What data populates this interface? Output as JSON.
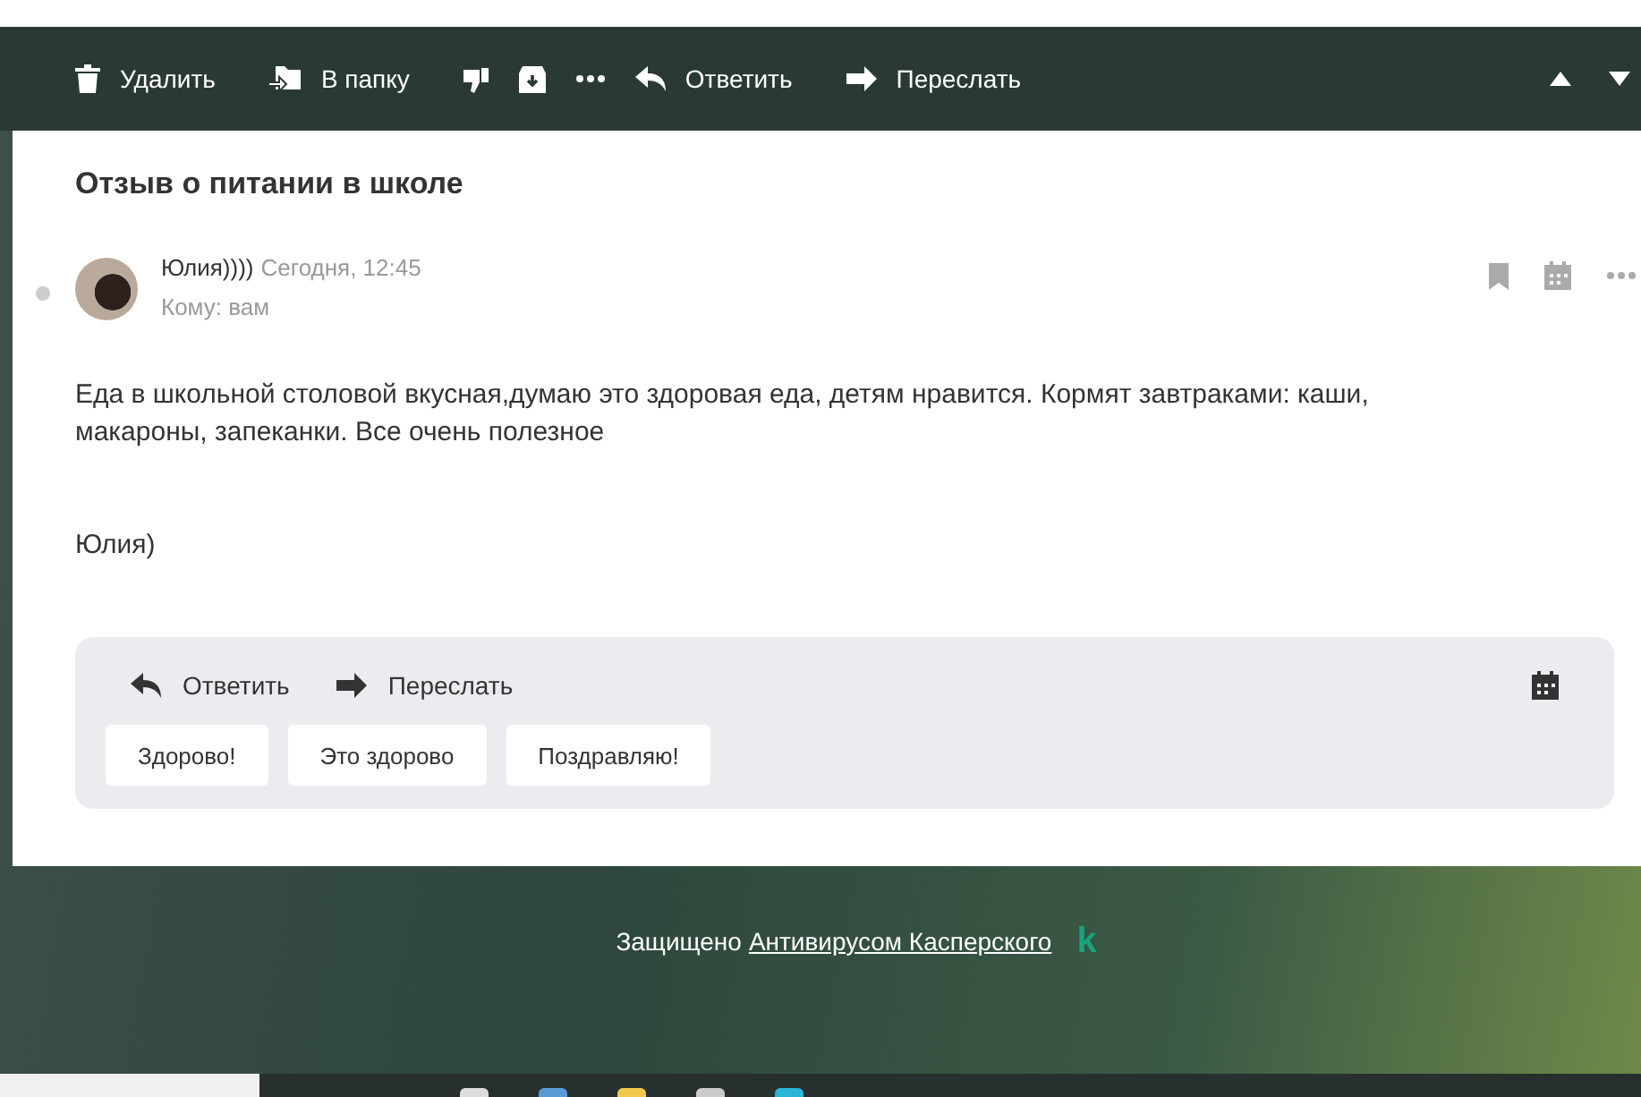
{
  "toolbar": {
    "actions": [
      {
        "kind": "delete",
        "label": "Удалить"
      },
      {
        "kind": "move",
        "label": "В папку"
      },
      {
        "kind": "spam"
      },
      {
        "kind": "archive"
      },
      {
        "kind": "more"
      },
      {
        "kind": "reply",
        "label": "Ответить"
      },
      {
        "kind": "forward",
        "label": "Переслать"
      }
    ]
  },
  "message": {
    "subject": "Отзыв о питании в школе",
    "unread": false,
    "sender": "Юлия))))",
    "date": "Сегодня, 12:45",
    "to_label": "Кому:",
    "to": "вам",
    "body": [
      "Еда в школьной столовой вкусная,думаю это здоровая еда, детям нравится. Кормят завтраками: каши, макароны, запеканки. Все очень полезное",
      "Юлия)"
    ]
  },
  "quick_reply": {
    "actions": [
      {
        "kind": "reply",
        "label": "Ответить"
      },
      {
        "kind": "forward",
        "label": "Переслать"
      }
    ],
    "suggestions": [
      "Здорово!",
      "Это здорово",
      "Поздравляю!"
    ]
  },
  "footer": {
    "text": "Защищено",
    "link": "Антивирусом Касперского",
    "logo": "k"
  }
}
